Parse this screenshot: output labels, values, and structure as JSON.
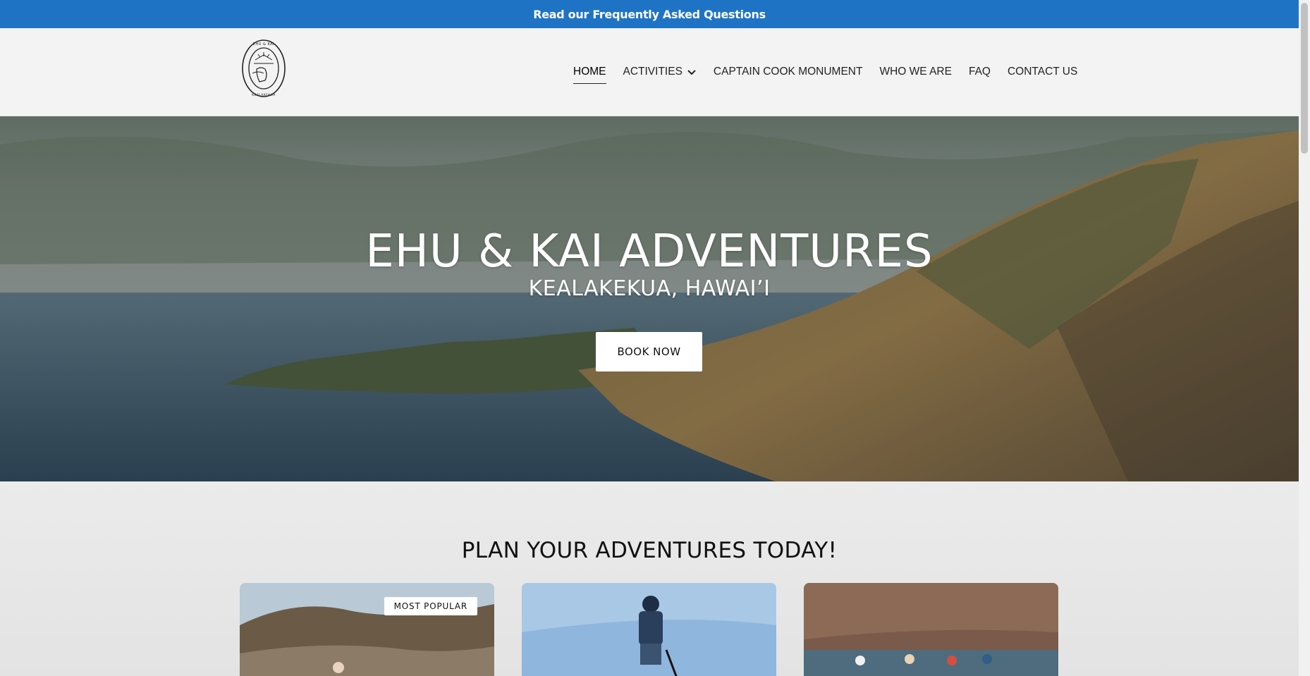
{
  "announcement": {
    "text": "Read our Frequently Asked Questions"
  },
  "header": {
    "logo_text": "EHU & KAI ADVENTURES · KEALAKEKUA, HAWAII",
    "nav": [
      {
        "label": "HOME",
        "active": true
      },
      {
        "label": "ACTIVITIES",
        "has_dropdown": true
      },
      {
        "label": "CAPTAIN COOK MONUMENT"
      },
      {
        "label": "WHO WE ARE"
      },
      {
        "label": "FAQ"
      },
      {
        "label": "CONTACT US"
      }
    ]
  },
  "hero": {
    "title": "EHU & KAI ADVENTURES",
    "subtitle": "KEALAKEKUA, HAWAI’I",
    "cta": "BOOK NOW"
  },
  "plan": {
    "title": "PLAN YOUR ADVENTURES TODAY!",
    "cards": [
      {
        "badge": "MOST POPULAR",
        "image": "hiking-trail"
      },
      {
        "image": "paddleboarder"
      },
      {
        "image": "kayak-group-cliffs"
      }
    ]
  },
  "colors": {
    "announcement_bg": "#1f73c4",
    "header_bg": "#f3f3f3",
    "button_bg": "#ffffff"
  }
}
